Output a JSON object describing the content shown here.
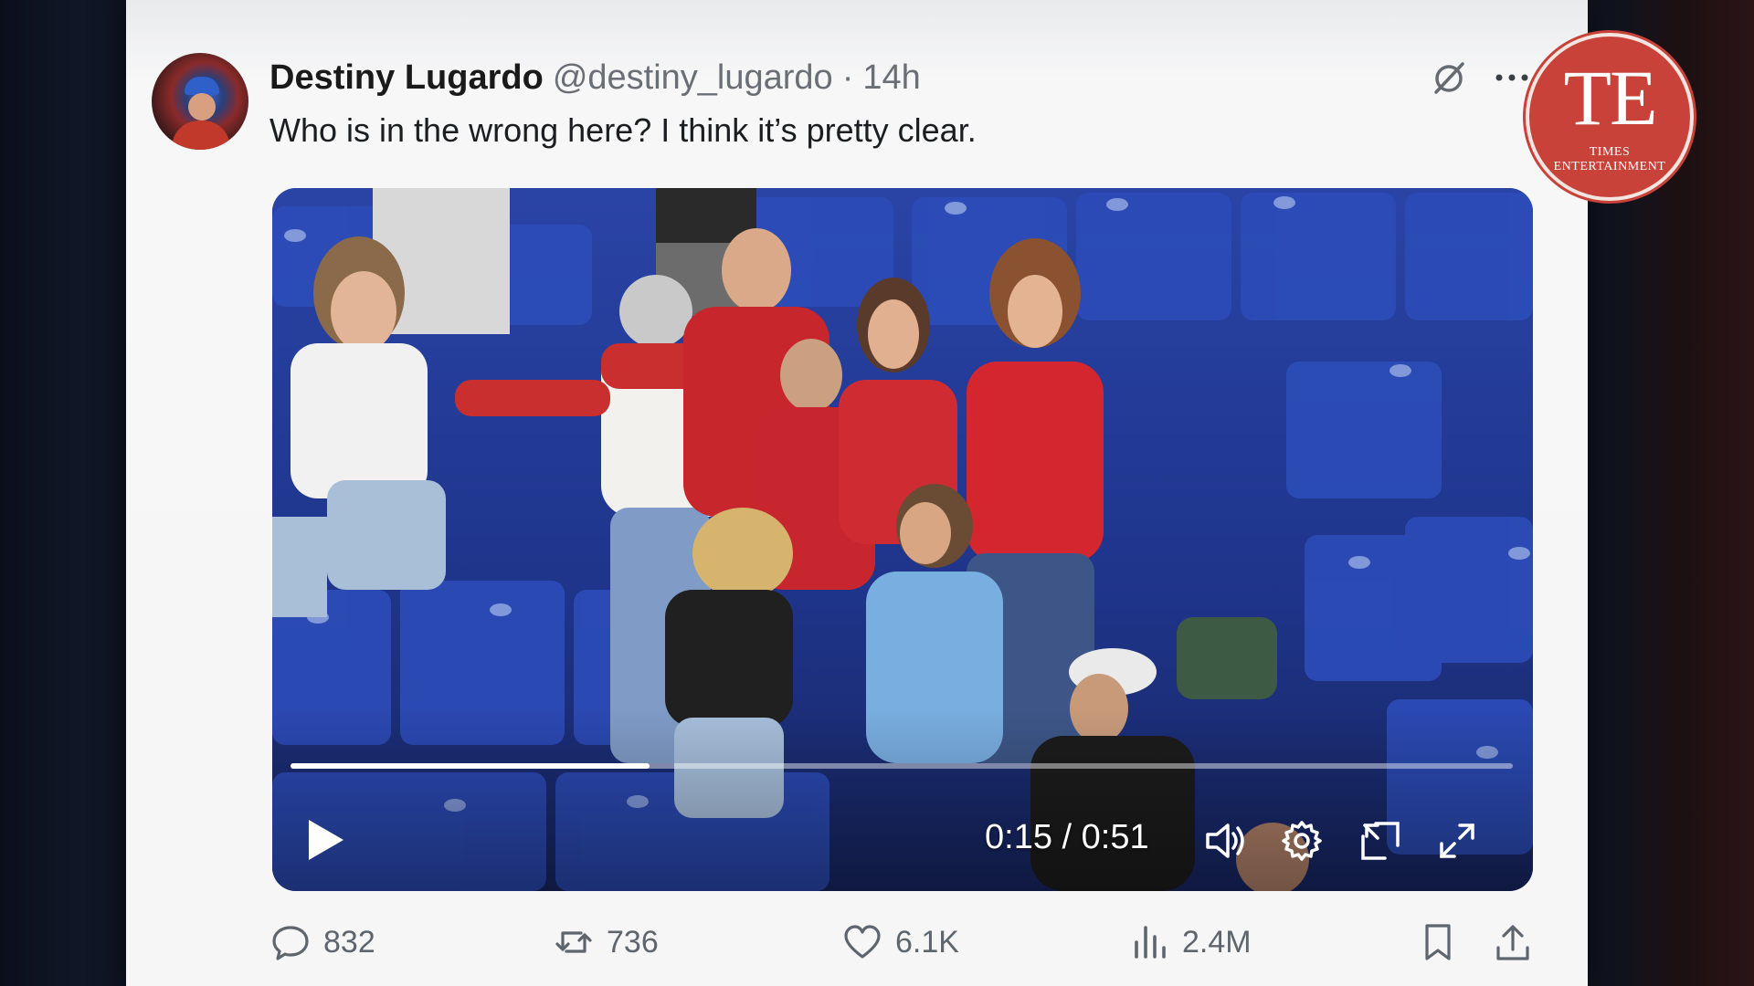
{
  "tweet": {
    "author_name": "Destiny Lugardo",
    "author_handle": "@destiny_lugardo",
    "separator": "·",
    "time_ago": "14h",
    "text": "Who is in the wrong here? I think it’s pretty clear."
  },
  "logo": {
    "mark": "TE",
    "line1": "TIMES",
    "line2": "ENTERTAINMENT"
  },
  "video": {
    "current_time": "0:15",
    "duration": "0:51",
    "time_display": "0:15 / 0:51",
    "progress_fraction": 0.294,
    "state": "paused"
  },
  "actions": {
    "replies": "832",
    "reposts": "736",
    "likes": "6.1K",
    "views": "2.4M"
  },
  "icons": {
    "grok": "grok-icon",
    "more": "more-icon",
    "play": "play-icon",
    "volume": "volume-icon",
    "settings": "gear-icon",
    "pip": "picture-in-picture-icon",
    "fullscreen": "fullscreen-icon",
    "reply": "reply-icon",
    "repost": "repost-icon",
    "like": "heart-icon",
    "views": "views-icon",
    "bookmark": "bookmark-icon",
    "share": "share-icon"
  },
  "colors": {
    "logo_red": "#c8423a",
    "seat_blue": "#1d2f7a",
    "text_primary": "#1b1d20",
    "text_secondary": "#6a6f76"
  }
}
